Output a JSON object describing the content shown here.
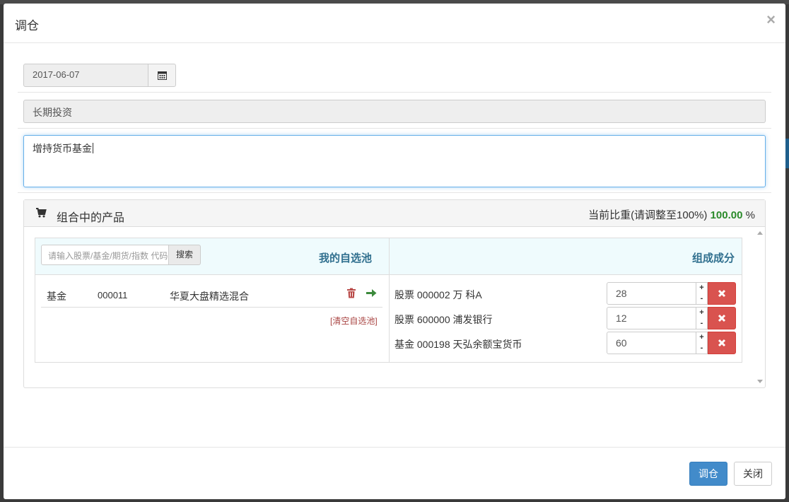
{
  "modal": {
    "title": "调仓",
    "close_glyph": "×"
  },
  "form": {
    "date_value": "2017-06-07",
    "type_value": "长期投资",
    "note_value": "增持货币基金"
  },
  "panel": {
    "title": "组合中的产品",
    "weight_prefix": "当前比重(请调整至100%)",
    "weight_value": "100.00",
    "weight_suffix": "%"
  },
  "favorites": {
    "search_placeholder": "请输入股票/基金/期货/指数 代码",
    "search_label": "搜索",
    "title": "我的自选池",
    "items": [
      {
        "type": "基金",
        "code": "000011",
        "name": "华夏大盘精选混合"
      }
    ],
    "clear_label": "[清空自选池]"
  },
  "composition": {
    "title": "组成成分",
    "items": [
      {
        "label": "股票 000002 万 科A",
        "value": "28"
      },
      {
        "label": "股票 600000 浦发银行",
        "value": "12"
      },
      {
        "label": "基金 000198 天弘余额宝货币",
        "value": "60"
      }
    ],
    "stepper_plus": "+",
    "stepper_minus": "-"
  },
  "footer": {
    "confirm_label": "调仓",
    "close_label": "关闭"
  },
  "colors": {
    "primary": "#428bca",
    "danger": "#d9534f",
    "success": "#2a8a2a",
    "heading_blue": "#31708f"
  },
  "icons": {
    "calendar": "calendar-icon",
    "cart": "shopping-cart-icon",
    "trash": "trash-icon",
    "arrow": "arrow-right-icon",
    "remove": "remove-icon"
  }
}
